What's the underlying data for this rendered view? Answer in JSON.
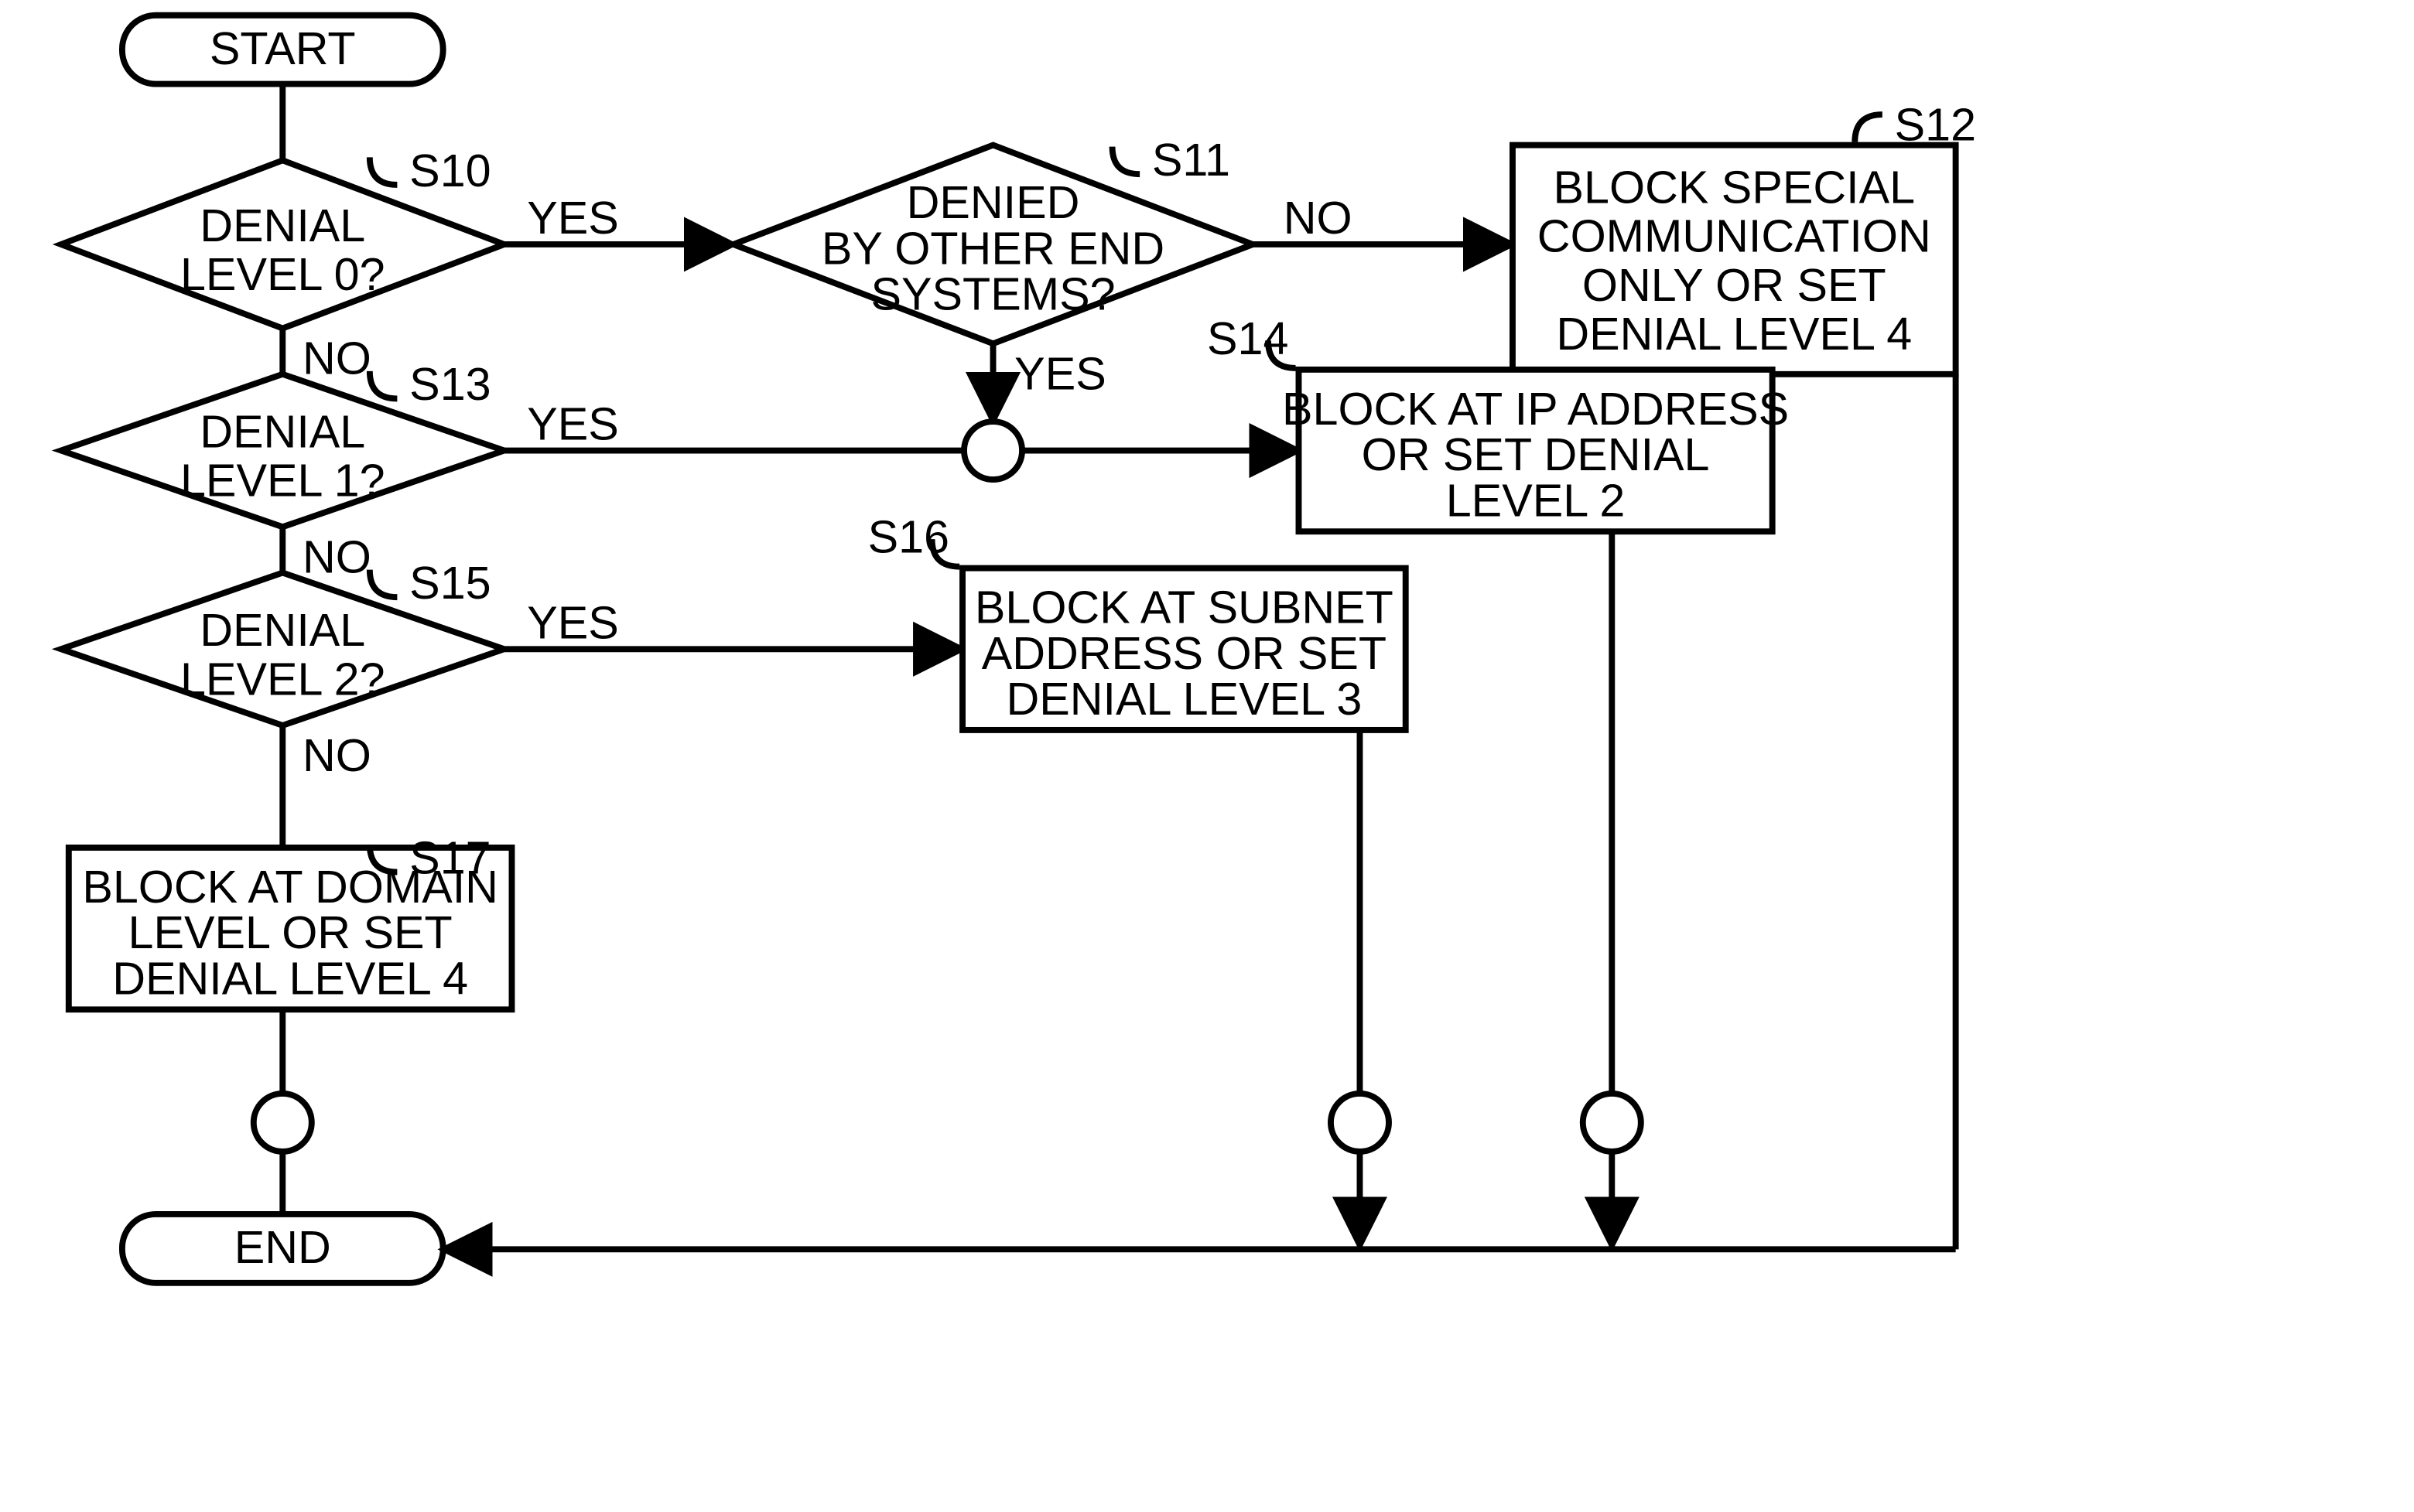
{
  "chart_data": {
    "type": "flowchart",
    "nodes": [
      {
        "id": "start",
        "kind": "terminator",
        "text": "START"
      },
      {
        "id": "s10",
        "kind": "decision",
        "label": "S10",
        "text": "DENIAL LEVEL 0?"
      },
      {
        "id": "s11",
        "kind": "decision",
        "label": "S11",
        "text": "DENIED BY OTHER END SYSTEMS?"
      },
      {
        "id": "s12",
        "kind": "process",
        "label": "S12",
        "text": "BLOCK SPECIAL COMMUNICATION ONLY OR SET DENIAL LEVEL 4"
      },
      {
        "id": "s13",
        "kind": "decision",
        "label": "S13",
        "text": "DENIAL LEVEL 1?"
      },
      {
        "id": "s14",
        "kind": "process",
        "label": "S14",
        "text": "BLOCK AT IP ADDRESS OR SET DENIAL LEVEL 2"
      },
      {
        "id": "s15",
        "kind": "decision",
        "label": "S15",
        "text": "DENIAL LEVEL 2?"
      },
      {
        "id": "s16",
        "kind": "process",
        "label": "S16",
        "text": "BLOCK AT SUBNET ADDRESS OR SET DENIAL LEVEL 3"
      },
      {
        "id": "s17",
        "kind": "process",
        "label": "S17",
        "text": "BLOCK AT DOMAIN LEVEL OR SET DENIAL LEVEL 4"
      },
      {
        "id": "end",
        "kind": "terminator",
        "text": "END"
      }
    ],
    "edges": [
      {
        "from": "start",
        "to": "s10"
      },
      {
        "from": "s10",
        "to": "s11",
        "label": "YES"
      },
      {
        "from": "s10",
        "to": "s13",
        "label": "NO"
      },
      {
        "from": "s11",
        "to": "s12",
        "label": "NO"
      },
      {
        "from": "s11",
        "to": "s14",
        "label": "YES",
        "via": "connector"
      },
      {
        "from": "s13",
        "to": "s14",
        "label": "YES",
        "via": "connector"
      },
      {
        "from": "s13",
        "to": "s15",
        "label": "NO"
      },
      {
        "from": "s15",
        "to": "s16",
        "label": "YES"
      },
      {
        "from": "s15",
        "to": "s17",
        "label": "NO"
      },
      {
        "from": "s12",
        "to": "end"
      },
      {
        "from": "s14",
        "to": "end",
        "via": "connector"
      },
      {
        "from": "s16",
        "to": "end",
        "via": "connector"
      },
      {
        "from": "s17",
        "to": "end",
        "via": "connector"
      }
    ]
  },
  "nodes": {
    "start": "START",
    "end": "END",
    "s10": {
      "label": "S10",
      "l1": "DENIAL",
      "l2": "LEVEL 0?"
    },
    "s11": {
      "label": "S11",
      "l1": "DENIED",
      "l2": "BY OTHER END",
      "l3": "SYSTEMS?"
    },
    "s12": {
      "label": "S12",
      "l1": "BLOCK SPECIAL",
      "l2": "COMMUNICATION",
      "l3": "ONLY OR SET",
      "l4": "DENIAL LEVEL 4"
    },
    "s13": {
      "label": "S13",
      "l1": "DENIAL",
      "l2": "LEVEL 1?"
    },
    "s14": {
      "label": "S14",
      "l1": "BLOCK AT IP ADDRESS",
      "l2": "OR SET DENIAL",
      "l3": "LEVEL 2"
    },
    "s15": {
      "label": "S15",
      "l1": "DENIAL",
      "l2": "LEVEL 2?"
    },
    "s16": {
      "label": "S16",
      "l1": "BLOCK AT SUBNET",
      "l2": "ADDRESS OR SET",
      "l3": "DENIAL LEVEL 3"
    },
    "s17": {
      "label": "S17",
      "l1": "BLOCK AT DOMAIN",
      "l2": "LEVEL OR SET",
      "l3": "DENIAL LEVEL 4"
    }
  },
  "edge_labels": {
    "yes": "YES",
    "no": "NO"
  }
}
